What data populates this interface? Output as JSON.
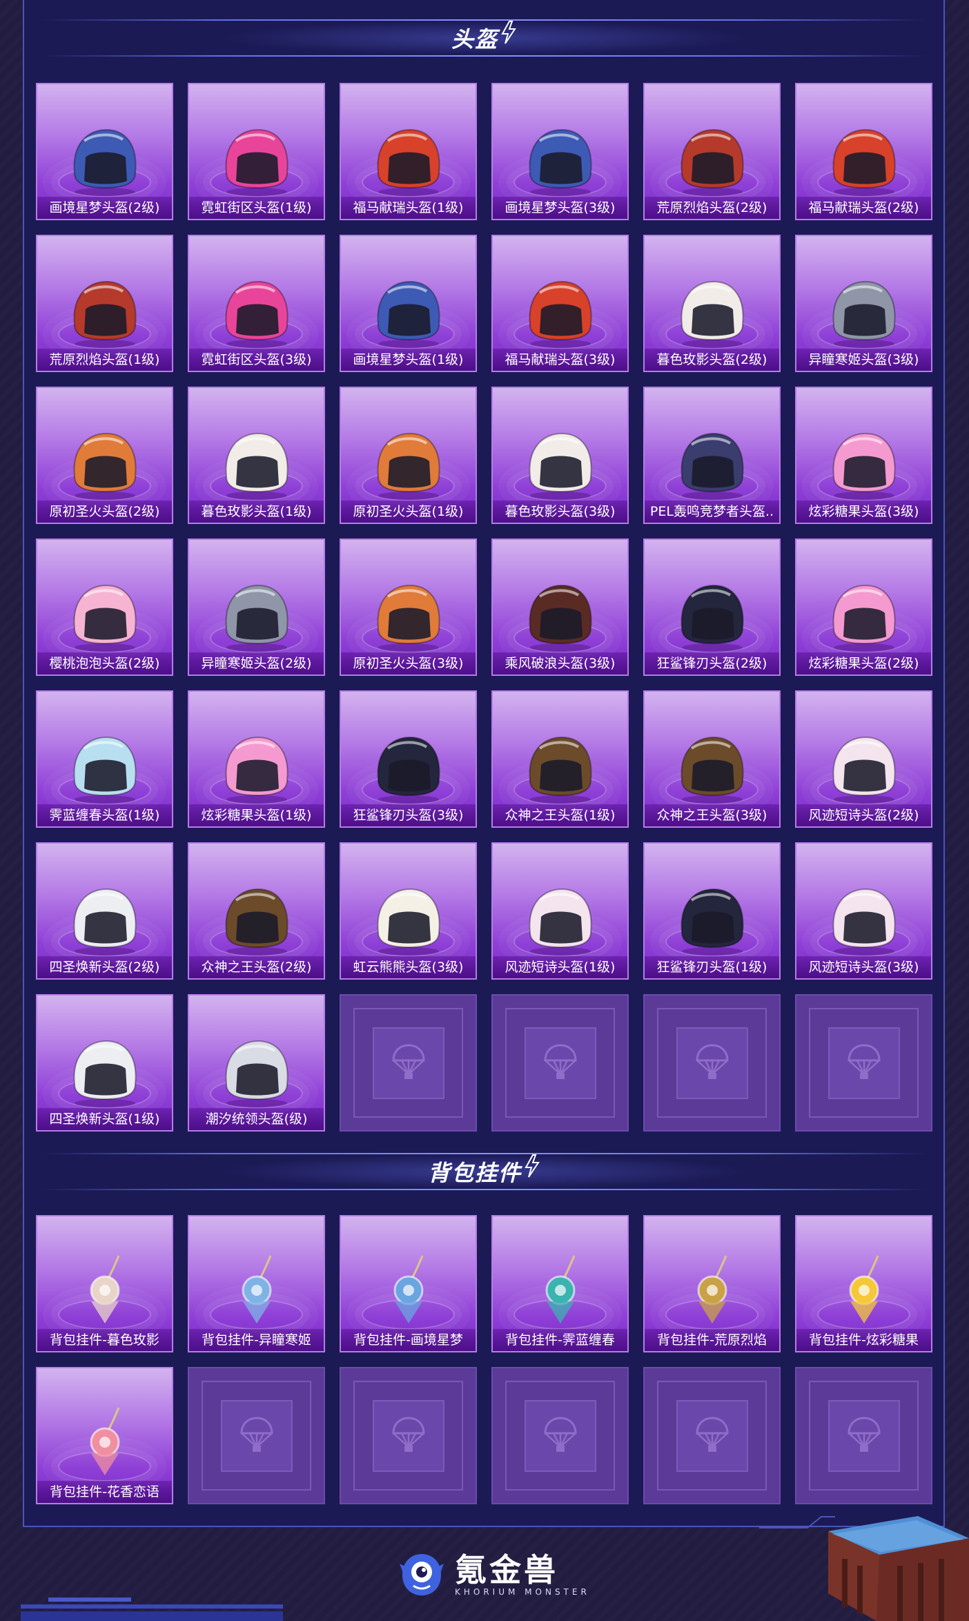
{
  "sections": {
    "helmets": {
      "title": "头盔"
    },
    "pendants": {
      "title": "背包挂件"
    }
  },
  "colors": {
    "panel": "#1b1a55",
    "card_top": "#d3b3ef",
    "card_bottom": "#7a2cc8",
    "label_bg": "#4d0f88",
    "empty_slot": "#5b3a98",
    "accent": "#6270e6"
  },
  "helmet_items": [
    {
      "label": "画境星梦头盔(2级)",
      "color": "#3d5bb5"
    },
    {
      "label": "霓虹街区头盔(1级)",
      "color": "#e8459a"
    },
    {
      "label": "福马献瑞头盔(1级)",
      "color": "#d8412a"
    },
    {
      "label": "画境星梦头盔(3级)",
      "color": "#3d5bb5"
    },
    {
      "label": "荒原烈焰头盔(2级)",
      "color": "#b53a2c"
    },
    {
      "label": "福马献瑞头盔(2级)",
      "color": "#d8412a"
    },
    {
      "label": "荒原烈焰头盔(1级)",
      "color": "#b53a2c"
    },
    {
      "label": "霓虹街区头盔(3级)",
      "color": "#e8459a"
    },
    {
      "label": "画境星梦头盔(1级)",
      "color": "#3d5bb5"
    },
    {
      "label": "福马献瑞头盔(3级)",
      "color": "#d8412a"
    },
    {
      "label": "暮色玫影头盔(2级)",
      "color": "#f2ece8"
    },
    {
      "label": "异瞳寒姬头盔(3级)",
      "color": "#8e96a8"
    },
    {
      "label": "原初圣火头盔(2级)",
      "color": "#e07b3a"
    },
    {
      "label": "暮色玫影头盔(1级)",
      "color": "#f2ece8"
    },
    {
      "label": "原初圣火头盔(1级)",
      "color": "#e07b3a"
    },
    {
      "label": "暮色玫影头盔(3级)",
      "color": "#f2ece8"
    },
    {
      "label": "PEL轰鸣竞梦者头盔..",
      "color": "#3a3d6e"
    },
    {
      "label": "炫彩糖果头盔(3级)",
      "color": "#f59ad0"
    },
    {
      "label": "樱桃泡泡头盔(2级)",
      "color": "#f7b4d2"
    },
    {
      "label": "异瞳寒姬头盔(2级)",
      "color": "#8e96a8"
    },
    {
      "label": "原初圣火头盔(3级)",
      "color": "#e07b3a"
    },
    {
      "label": "乘风破浪头盔(3级)",
      "color": "#5a2b24"
    },
    {
      "label": "狂鲨锋刃头盔(2级)",
      "color": "#23263d"
    },
    {
      "label": "炫彩糖果头盔(2级)",
      "color": "#f59ad0"
    },
    {
      "label": "霁蓝缠春头盔(1级)",
      "color": "#b8dff0"
    },
    {
      "label": "炫彩糖果头盔(1级)",
      "color": "#f59ad0"
    },
    {
      "label": "狂鲨锋刃头盔(3级)",
      "color": "#23263d"
    },
    {
      "label": "众神之王头盔(1级)",
      "color": "#6b4b2a"
    },
    {
      "label": "众神之王头盔(3级)",
      "color": "#6b4b2a"
    },
    {
      "label": "风迹短诗头盔(2级)",
      "color": "#f3e4ee"
    },
    {
      "label": "四圣焕新头盔(2级)",
      "color": "#eceef2"
    },
    {
      "label": "众神之王头盔(2级)",
      "color": "#6b4b2a"
    },
    {
      "label": "虹云熊熊头盔(3级)",
      "color": "#f4f0e6"
    },
    {
      "label": "风迹短诗头盔(1级)",
      "color": "#f3e4ee"
    },
    {
      "label": "狂鲨锋刃头盔(1级)",
      "color": "#23263d"
    },
    {
      "label": "风迹短诗头盔(3级)",
      "color": "#f3e4ee"
    },
    {
      "label": "四圣焕新头盔(1级)",
      "color": "#eceef2"
    },
    {
      "label": "潮汐统领头盔(级)",
      "color": "#d9dce4"
    }
  ],
  "helmet_empty_slots": 4,
  "pendant_items": [
    {
      "label": "背包挂件-暮色玫影",
      "color": "#e8d4c8"
    },
    {
      "label": "背包挂件-异瞳寒姬",
      "color": "#7fb3e6"
    },
    {
      "label": "背包挂件-画境星梦",
      "color": "#6aa5e0"
    },
    {
      "label": "背包挂件-霁蓝缠春",
      "color": "#3bb3b0"
    },
    {
      "label": "背包挂件-荒原烈焰",
      "color": "#c9a247"
    },
    {
      "label": "背包挂件-炫彩糖果",
      "color": "#f5c83a"
    },
    {
      "label": "背包挂件-花香恋语",
      "color": "#f08fa0"
    }
  ],
  "pendant_empty_slots": 5,
  "footer": {
    "brand_cn": "氪金兽",
    "brand_en": "KHORIUM MONSTER"
  }
}
